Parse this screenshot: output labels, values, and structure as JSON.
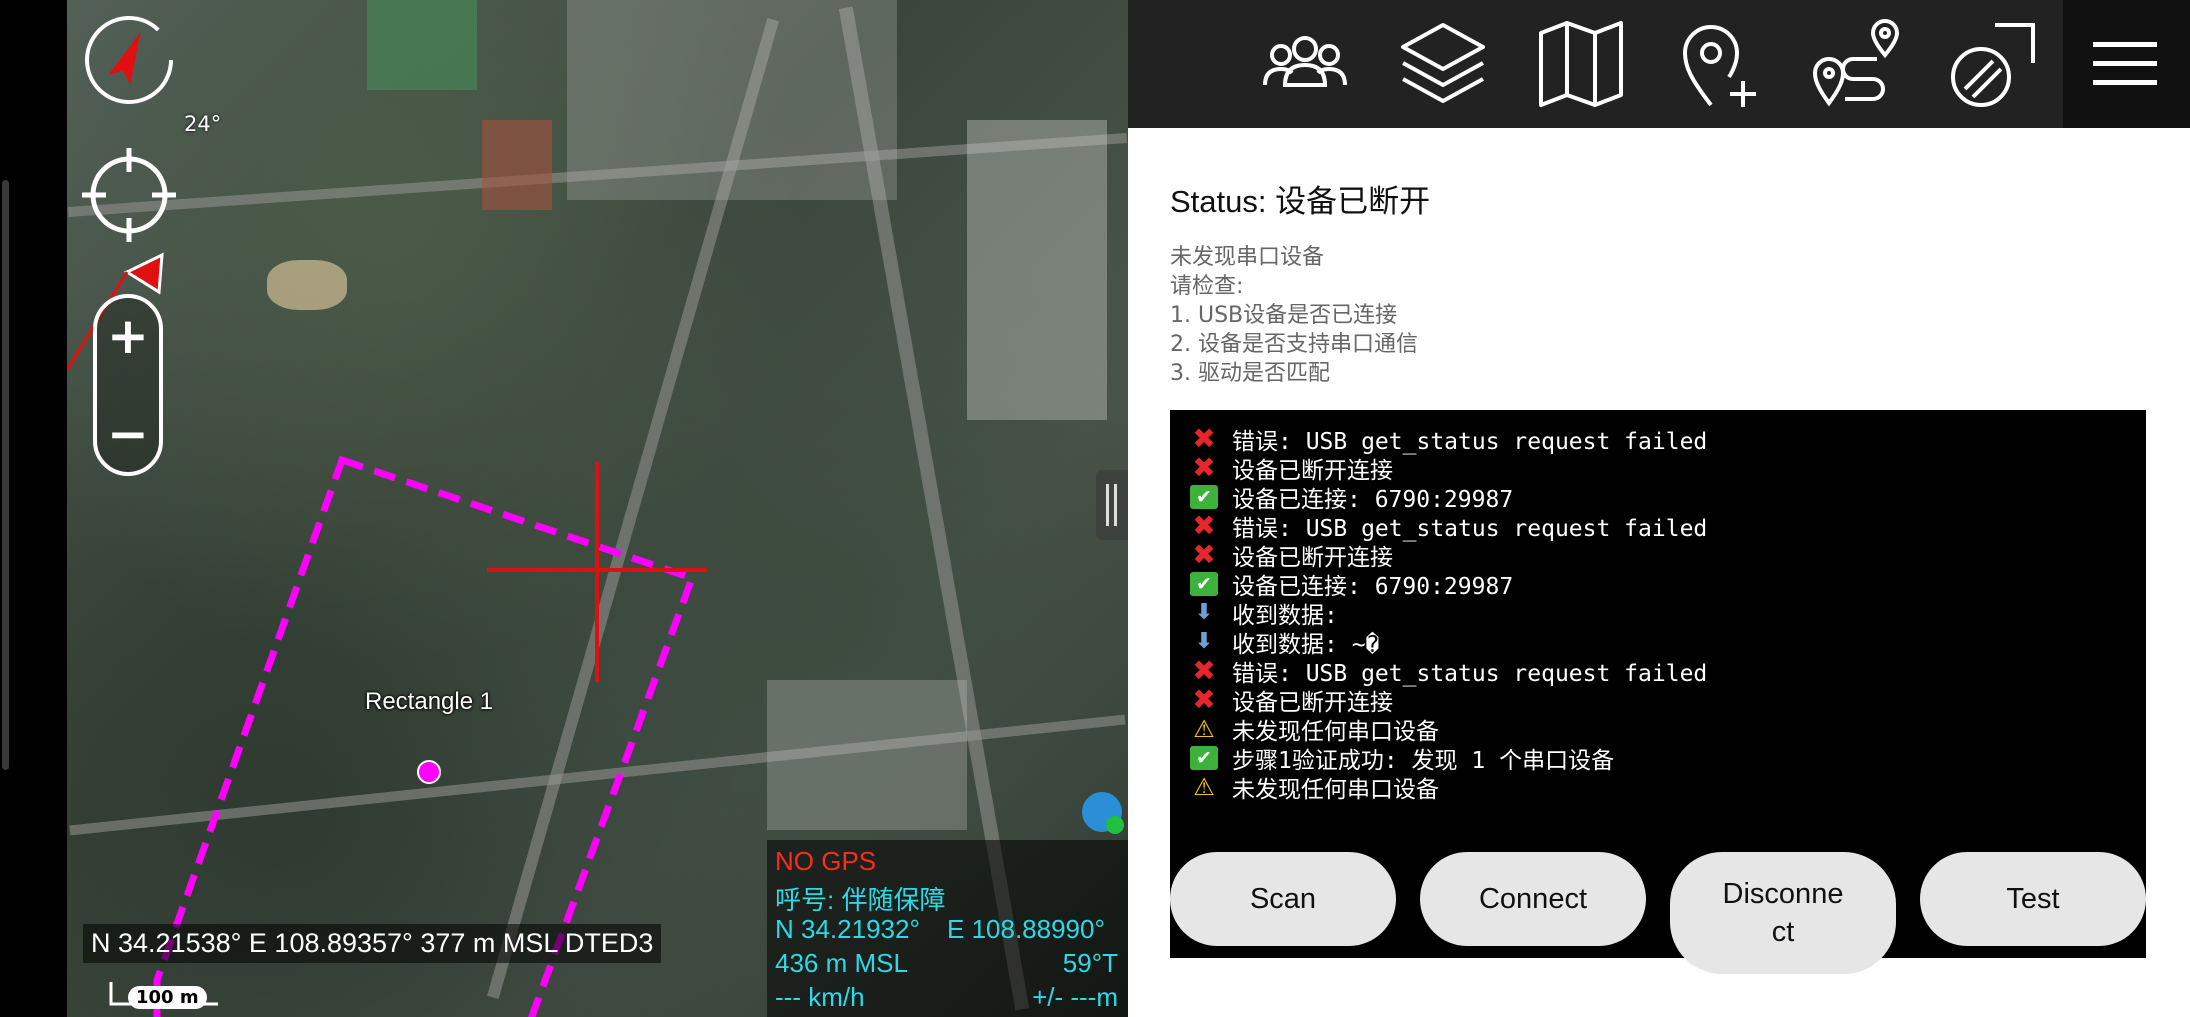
{
  "map": {
    "compass_heading": "24°",
    "zoom_in": "+",
    "zoom_out": "−",
    "shape_label": "Rectangle 1",
    "cursor_coordinates": "N 34.21538°  E 108.89357° 377 m MSL DTED3",
    "scale": "100 m",
    "gps": {
      "status": "NO GPS",
      "callsign": "呼号: 伴随保障",
      "lat": "N 34.21932°",
      "lon": "E 108.88990°",
      "altitude": "436 m MSL",
      "temperature": "59°T",
      "speed": "--- km/h",
      "accuracy": "+/- ---m"
    }
  },
  "toolbar": {
    "icons": [
      "team-icon",
      "layers-icon",
      "map-icon",
      "add-point-icon",
      "route-icon",
      "draw-icon",
      "menu-icon"
    ]
  },
  "panel": {
    "status": "Status: 设备已断开",
    "hint_lines": [
      "未发现串口设备",
      "请检查:",
      "1. USB设备是否已连接",
      "2. 设备是否支持串口通信",
      "3. 驱动是否匹配"
    ],
    "log": [
      {
        "type": "error",
        "icon": "✖",
        "text": "错误: USB get_status request failed"
      },
      {
        "type": "error",
        "icon": "✖",
        "text": "设备已断开连接"
      },
      {
        "type": "ok",
        "icon": "✔",
        "text": "设备已连接: 6790:29987"
      },
      {
        "type": "error",
        "icon": "✖",
        "text": "错误: USB get_status request failed"
      },
      {
        "type": "error",
        "icon": "✖",
        "text": "设备已断开连接"
      },
      {
        "type": "ok",
        "icon": "✔",
        "text": "设备已连接: 6790:29987"
      },
      {
        "type": "recv",
        "icon": "⬇",
        "text": "收到数据:"
      },
      {
        "type": "recv",
        "icon": "⬇",
        "text": "收到数据: ~�"
      },
      {
        "type": "error",
        "icon": "✖",
        "text": "错误: USB get_status request failed"
      },
      {
        "type": "error",
        "icon": "✖",
        "text": "设备已断开连接"
      },
      {
        "type": "warn",
        "icon": "⚠",
        "text": "未发现任何串口设备"
      },
      {
        "type": "ok",
        "icon": "✔",
        "text": "步骤1验证成功: 发现 1 个串口设备"
      },
      {
        "type": "warn",
        "icon": "⚠",
        "text": "未发现任何串口设备"
      }
    ],
    "buttons": {
      "scan": "Scan",
      "connect": "Connect",
      "disconnect_line1": "Disconne",
      "disconnect_line2": "ct",
      "test": "Test"
    }
  },
  "colors": {
    "drawing_shape": "#ff00ff",
    "crosshair": "#e01010",
    "gps_text": "#2fd8e6",
    "no_gps": "#ff2a1a"
  }
}
